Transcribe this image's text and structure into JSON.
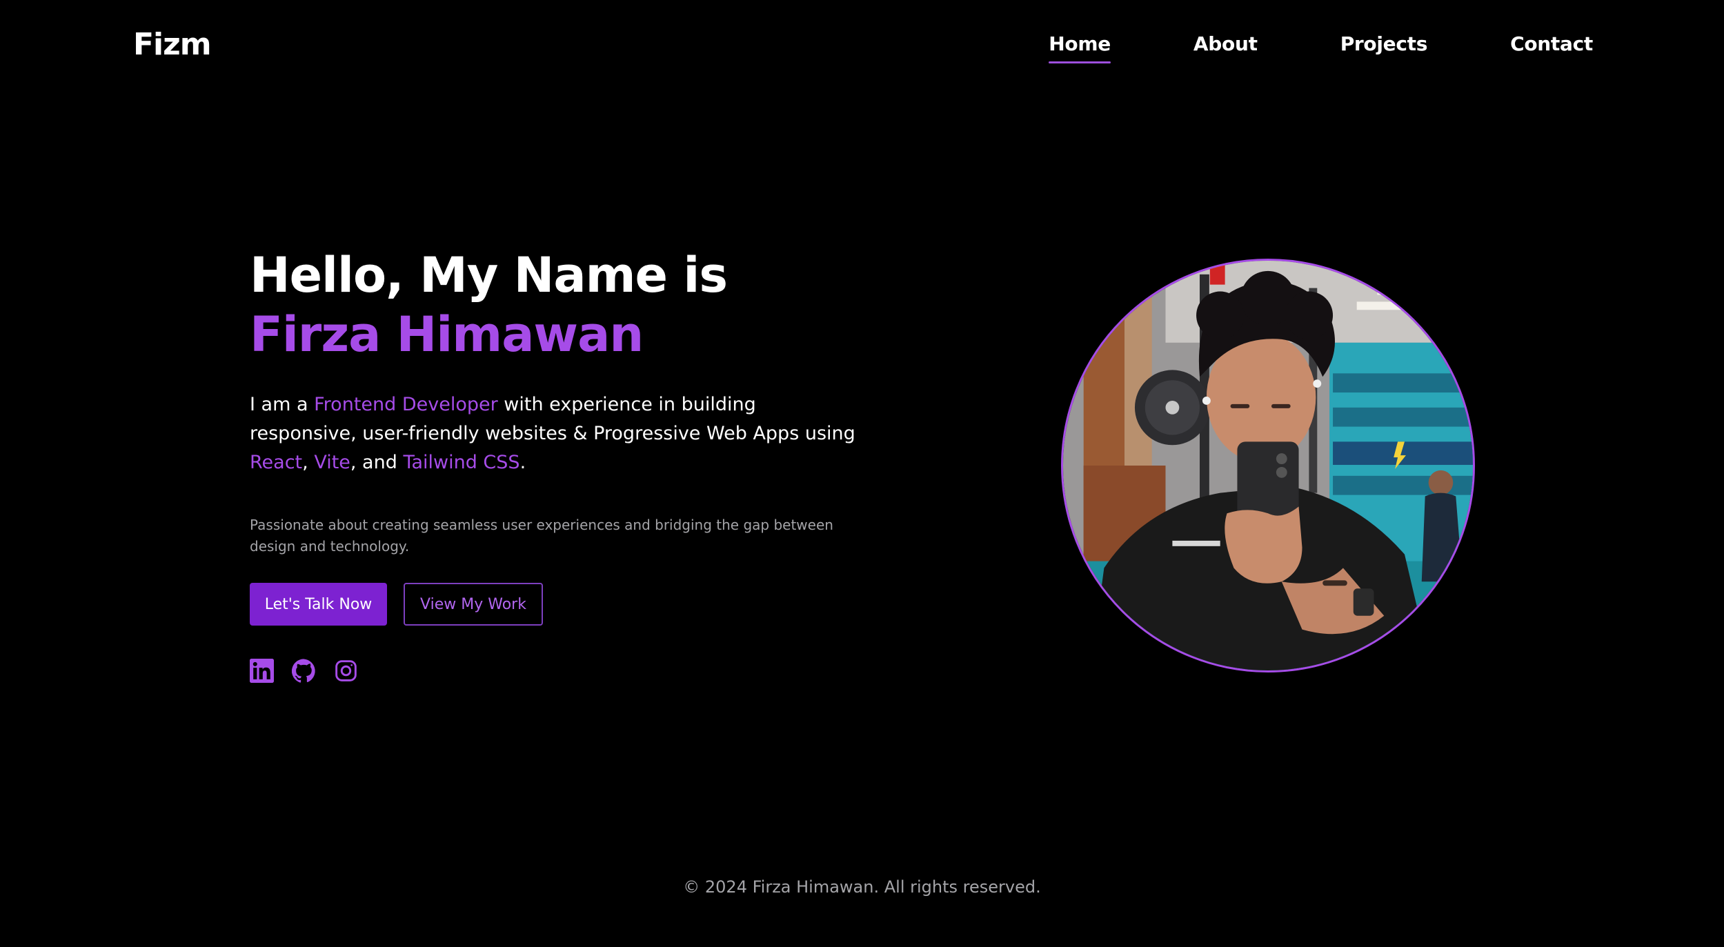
{
  "header": {
    "logo": "Fizm",
    "nav": [
      {
        "label": "Home",
        "active": true
      },
      {
        "label": "About",
        "active": false
      },
      {
        "label": "Projects",
        "active": false
      },
      {
        "label": "Contact",
        "active": false
      }
    ]
  },
  "hero": {
    "greeting": "Hello, My Name is",
    "name": "Firza Himawan",
    "intro": {
      "p1": "I am a ",
      "role": "Frontend Developer",
      "p2": " with experience in building responsive, user-friendly websites & Progressive Web Apps using ",
      "tech1": "React",
      "sep1": ", ",
      "tech2": "Vite",
      "sep2": ", and ",
      "tech3": "Tailwind CSS",
      "end": "."
    },
    "tagline": "Passionate about creating seamless user experiences and bridging the gap between design and technology.",
    "primary_button": "Let's Talk Now",
    "secondary_button": "View My Work",
    "socials": [
      "linkedin-icon",
      "github-icon",
      "instagram-icon"
    ]
  },
  "footer": {
    "copyright": "© 2024 Firza Himawan. All rights reserved."
  },
  "colors": {
    "background": "#000000",
    "accent": "#a64ce8",
    "button": "#7d22d1",
    "muted_text": "#a4a4a8"
  }
}
